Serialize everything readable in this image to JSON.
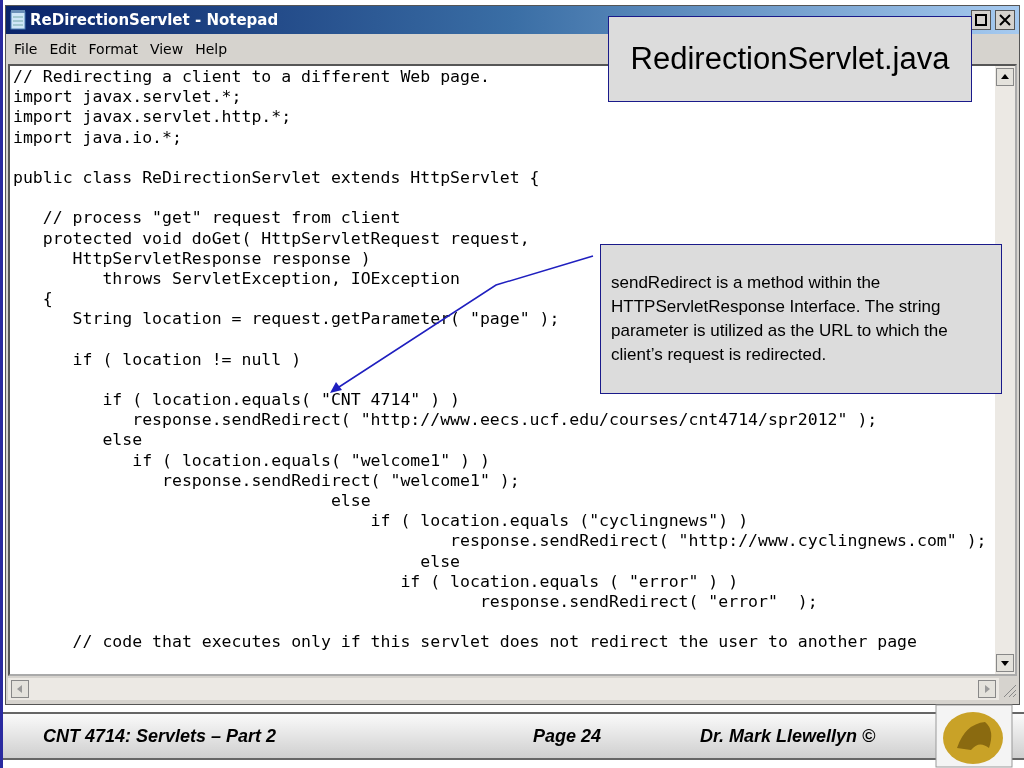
{
  "window": {
    "title": "ReDirectionServlet - Notepad"
  },
  "menu": [
    "File",
    "Edit",
    "Format",
    "View",
    "Help"
  ],
  "code_blocks": [
    [
      "// Redirecting a client to a different Web page.",
      "import javax.servlet.*;",
      "import javax.servlet.http.*;",
      "import java.io.*;"
    ],
    [
      "public class ReDirectionServlet extends HttpServlet {"
    ],
    [
      "   // process \"get\" request from client",
      "   protected void doGet( HttpServletRequest request,",
      "      HttpServletResponse response )",
      "         throws ServletException, IOException",
      "   {",
      "      String location = request.getParameter( \"page\" );"
    ],
    [
      "      if ( location != null )"
    ],
    [
      "         if ( location.equals( \"CNT 4714\" ) )",
      "            response.sendRedirect( \"http://www.eecs.ucf.edu/courses/cnt4714/spr2012\" );",
      "         else",
      "            if ( location.equals( \"welcome1\" ) )",
      "               response.sendRedirect( \"welcome1\" );",
      "                                else",
      "                                    if ( location.equals (\"cyclingnews\") )",
      "                                            response.sendRedirect( \"http://www.cyclingnews.com\" );",
      "                                         else",
      "                                       if ( location.equals ( \"error\" ) )",
      "                                               response.sendRedirect( \"error\"  );"
    ],
    [
      "      // code that executes only if this servlet does not redirect the user to another page"
    ]
  ],
  "slide_title": "RedirectionServlet.java",
  "callout": "sendRedirect is a method within the HTTPServletResponse Interface.  The string parameter is utilized as the URL to which the client’s request is redirected.",
  "footer": {
    "course": "CNT 4714: Servlets – Part 2",
    "page": "Page 24",
    "author": "Dr. Mark Llewellyn ©"
  }
}
